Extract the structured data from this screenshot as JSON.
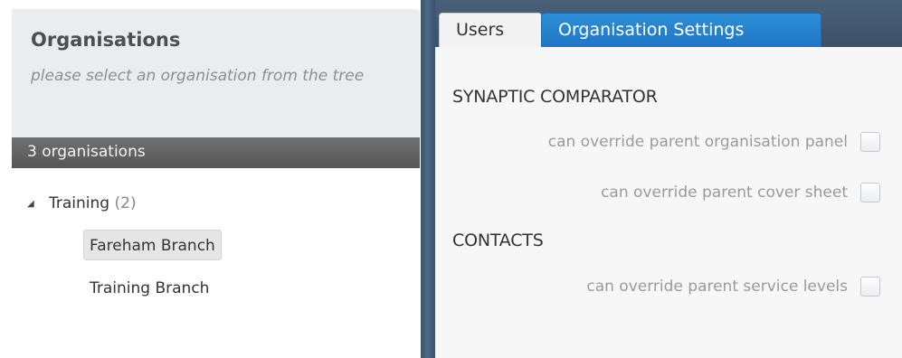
{
  "left_panel": {
    "title": "Organisations",
    "subtitle": "please select an organisation from the tree",
    "count_label": "3 organisations",
    "tree": {
      "root": {
        "label": "Training",
        "count": "(2)",
        "expanded": true
      },
      "children": [
        {
          "label": "Fareham Branch",
          "selected": true
        },
        {
          "label": "Training Branch",
          "selected": false
        }
      ]
    }
  },
  "tabs": [
    {
      "label": "Users",
      "active": false
    },
    {
      "label": "Organisation Settings",
      "active": true
    }
  ],
  "settings": {
    "sections": [
      {
        "title": "SYNAPTIC COMPARATOR",
        "options": [
          {
            "label": "can override parent organisation panel",
            "checked": false
          },
          {
            "label": "can override parent cover sheet",
            "checked": false
          }
        ]
      },
      {
        "title": "CONTACTS",
        "options": [
          {
            "label": "can override parent service levels",
            "checked": false
          }
        ]
      }
    ]
  },
  "colors": {
    "active_tab": "#1f76c4",
    "tabstrip": "#3c5068",
    "count_bar": "#565656",
    "header_bg": "#e9edf0"
  },
  "icons": {
    "tree_toggle": "triangle-expanded-icon"
  }
}
